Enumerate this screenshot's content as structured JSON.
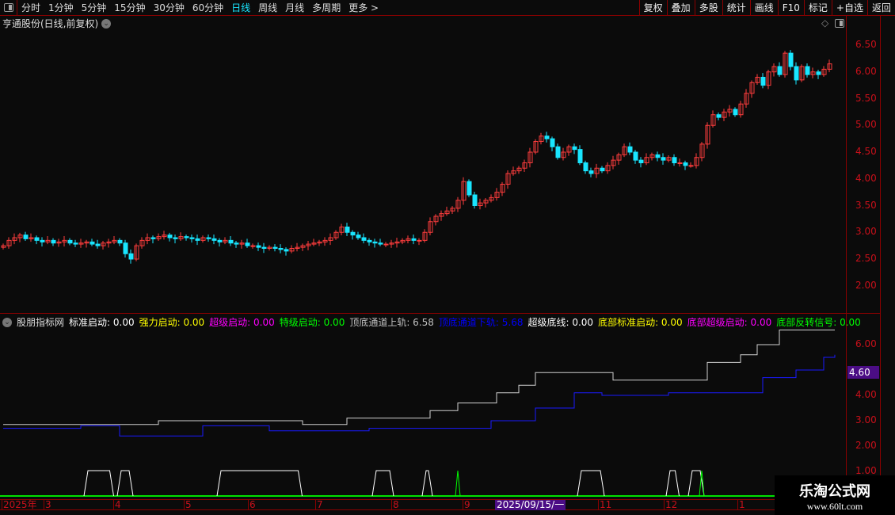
{
  "toolbar": {
    "periods": [
      "分时",
      "1分钟",
      "5分钟",
      "15分钟",
      "30分钟",
      "60分钟",
      "日线",
      "周线",
      "月线",
      "多周期",
      "更多 >"
    ],
    "active": "日线",
    "right_buttons": [
      "复权",
      "叠加",
      "多股",
      "统计",
      "画线",
      "F10",
      "标记",
      "+自选",
      "返回"
    ]
  },
  "main": {
    "title": "亨通股份(日线,前复权)",
    "yticks": [
      "6.50",
      "6.00",
      "5.50",
      "5.00",
      "4.50",
      "4.00",
      "3.50",
      "3.00",
      "2.50",
      "2.00"
    ]
  },
  "indicator": {
    "name": "股朋指标网",
    "items": [
      {
        "label": "标准启动: 0.00",
        "color": "#ffffff"
      },
      {
        "label": "强力启动: 0.00",
        "color": "#ffff00"
      },
      {
        "label": "超级启动: 0.00",
        "color": "#ff00ff"
      },
      {
        "label": "特级启动: 0.00",
        "color": "#00ff00"
      },
      {
        "label": "顶底通道上轨: 6.58",
        "color": "#c0c0c0"
      },
      {
        "label": "顶底通道下轨: 5.68",
        "color": "#0000ff"
      },
      {
        "label": "超级底线: 0.00",
        "color": "#ffffff"
      },
      {
        "label": "底部标准启动: 0.00",
        "color": "#ffff00"
      },
      {
        "label": "底部超级启动: 0.00",
        "color": "#ff00ff"
      },
      {
        "label": "底部反转信号: 0.00",
        "color": "#00ff00"
      }
    ],
    "yticks": [
      "6.00",
      "4.00",
      "3.00",
      "2.00",
      "1.00"
    ],
    "price_tag": "4.60"
  },
  "xaxis": {
    "labels": [
      "2025年",
      "3",
      "4",
      "5",
      "6",
      "7",
      "8",
      "9",
      "11",
      "12",
      "1"
    ],
    "highlight": "2025/09/15/一"
  },
  "watermark": {
    "line1": "乐淘公式网",
    "line2": "www.60lt.com"
  },
  "chart_data": {
    "type": "candlestick",
    "ylim": [
      1.7,
      6.7
    ],
    "up_color": "#ff3c3c",
    "down_color": "#19e6ff",
    "closes": [
      2.75,
      2.85,
      2.9,
      2.95,
      2.88,
      2.9,
      2.85,
      2.82,
      2.85,
      2.8,
      2.82,
      2.85,
      2.8,
      2.78,
      2.8,
      2.82,
      2.78,
      2.75,
      2.8,
      2.82,
      2.85,
      2.8,
      2.6,
      2.5,
      2.75,
      2.85,
      2.9,
      2.88,
      2.92,
      2.95,
      2.9,
      2.88,
      2.92,
      2.9,
      2.88,
      2.85,
      2.9,
      2.88,
      2.85,
      2.82,
      2.85,
      2.8,
      2.78,
      2.8,
      2.75,
      2.75,
      2.72,
      2.7,
      2.72,
      2.7,
      2.68,
      2.65,
      2.7,
      2.72,
      2.75,
      2.78,
      2.8,
      2.82,
      2.85,
      2.9,
      3.0,
      3.1,
      3.0,
      2.95,
      2.9,
      2.85,
      2.82,
      2.8,
      2.78,
      2.78,
      2.8,
      2.82,
      2.85,
      2.88,
      2.85,
      2.85,
      3.0,
      3.2,
      3.3,
      3.35,
      3.4,
      3.45,
      3.6,
      3.95,
      3.7,
      3.5,
      3.55,
      3.6,
      3.65,
      3.75,
      3.9,
      4.1,
      4.15,
      4.2,
      4.3,
      4.5,
      4.7,
      4.8,
      4.75,
      4.6,
      4.4,
      4.5,
      4.6,
      4.55,
      4.3,
      4.15,
      4.1,
      4.2,
      4.15,
      4.25,
      4.35,
      4.45,
      4.6,
      4.5,
      4.35,
      4.3,
      4.4,
      4.45,
      4.4,
      4.35,
      4.4,
      4.3,
      4.3,
      4.25,
      4.25,
      4.4,
      4.65,
      5.0,
      5.2,
      5.15,
      5.25,
      5.3,
      5.2,
      5.4,
      5.6,
      5.8,
      5.9,
      5.75,
      6.0,
      6.1,
      5.95,
      6.35,
      6.1,
      5.85,
      6.1,
      5.95,
      6.0,
      5.95,
      6.05,
      6.15
    ],
    "indicator": {
      "ylim": [
        0.8,
        6.8
      ],
      "upper_steps": [
        [
          0,
          2.85
        ],
        [
          28,
          3.0
        ],
        [
          54,
          2.85
        ],
        [
          62,
          3.1
        ],
        [
          77,
          3.4
        ],
        [
          82,
          3.7
        ],
        [
          89,
          4.1
        ],
        [
          93,
          4.4
        ],
        [
          96,
          4.9
        ],
        [
          110,
          4.6
        ],
        [
          127,
          5.3
        ],
        [
          133,
          5.6
        ],
        [
          136,
          6.0
        ],
        [
          140,
          6.58
        ],
        [
          150,
          6.58
        ]
      ],
      "lower_steps": [
        [
          0,
          2.7
        ],
        [
          14,
          2.8
        ],
        [
          21,
          2.4
        ],
        [
          36,
          2.8
        ],
        [
          48,
          2.6
        ],
        [
          66,
          2.7
        ],
        [
          88,
          3.0
        ],
        [
          96,
          3.5
        ],
        [
          103,
          4.1
        ],
        [
          108,
          4.0
        ],
        [
          120,
          4.1
        ],
        [
          137,
          4.7
        ],
        [
          143,
          5.0
        ],
        [
          148,
          5.5
        ],
        [
          150,
          5.6
        ]
      ],
      "pulses_white": [
        [
          15,
          19.5
        ],
        [
          21,
          23
        ],
        [
          39,
          53.5
        ],
        [
          67,
          70
        ],
        [
          76,
          77
        ],
        [
          104,
          108
        ],
        [
          120,
          121.5
        ],
        [
          124,
          126
        ]
      ],
      "pulses_green": [
        82,
        126
      ]
    }
  }
}
